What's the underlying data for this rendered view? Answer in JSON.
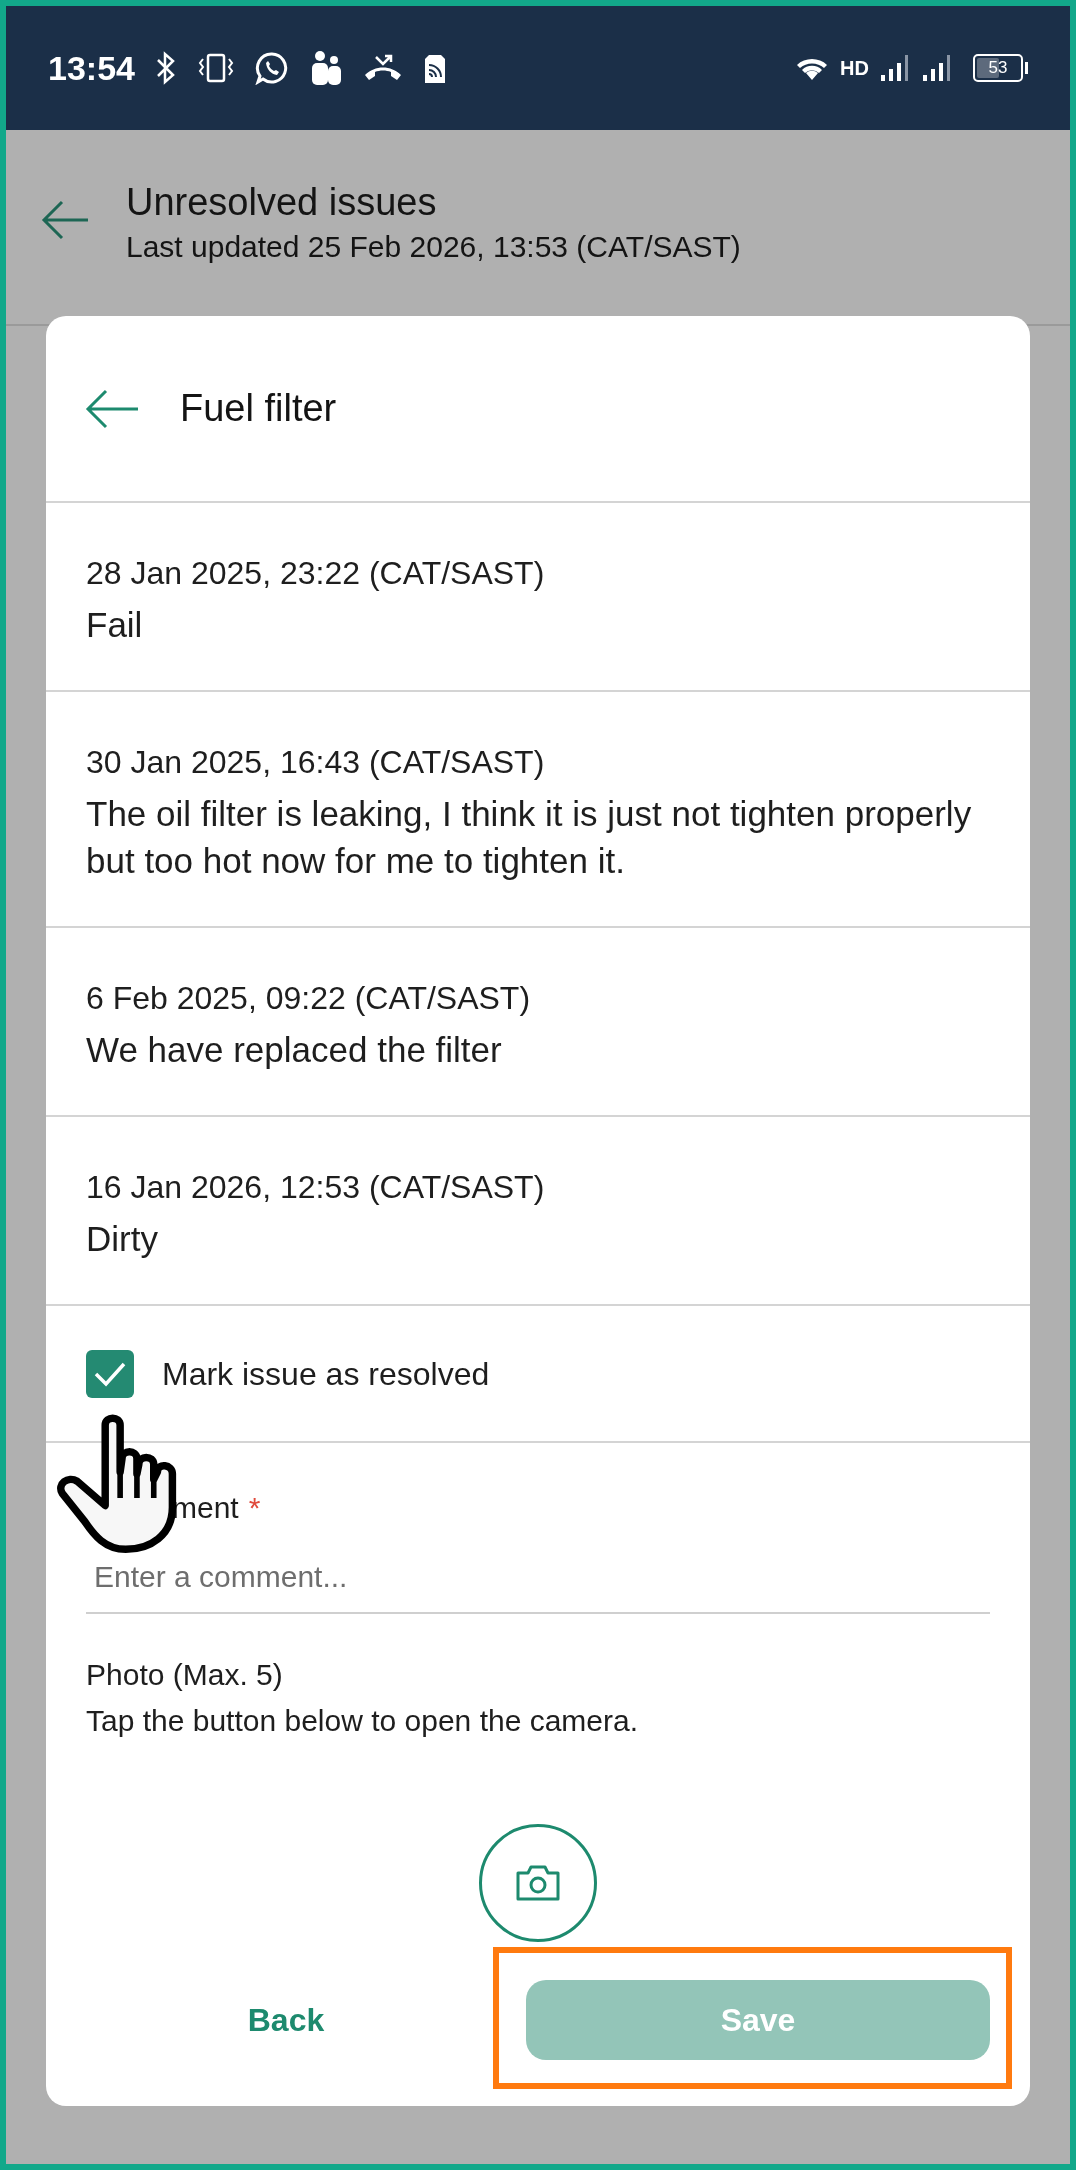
{
  "status_bar": {
    "time": "13:54",
    "network": "HD",
    "battery": "53"
  },
  "header": {
    "title": "Unresolved issues",
    "subtitle": "Last updated 25 Feb 2026, 13:53 (CAT/SAST)"
  },
  "dialog": {
    "title": "Fuel filter",
    "entries": [
      {
        "date": "28 Jan 2025, 23:22 (CAT/SAST)",
        "text": "Fail"
      },
      {
        "date": "30 Jan 2025, 16:43 (CAT/SAST)",
        "text": "The oil filter is leaking, I think it is just not tighten properly but too hot now for me to tighten it."
      },
      {
        "date": "6 Feb 2025, 09:22 (CAT/SAST)",
        "text": "We have replaced the filter"
      },
      {
        "date": "16 Jan 2026, 12:53 (CAT/SAST)",
        "text": "Dirty"
      }
    ],
    "resolved": {
      "label": "Mark issue as resolved",
      "checked": true
    },
    "comment": {
      "label": "ment",
      "required_mark": "*",
      "placeholder": "Enter a comment..."
    },
    "photo": {
      "label": "Photo (Max. 5)",
      "hint": "Tap the button below to open the camera."
    },
    "buttons": {
      "back": "Back",
      "save": {
        "label": "Save",
        "disabled": true
      }
    }
  }
}
